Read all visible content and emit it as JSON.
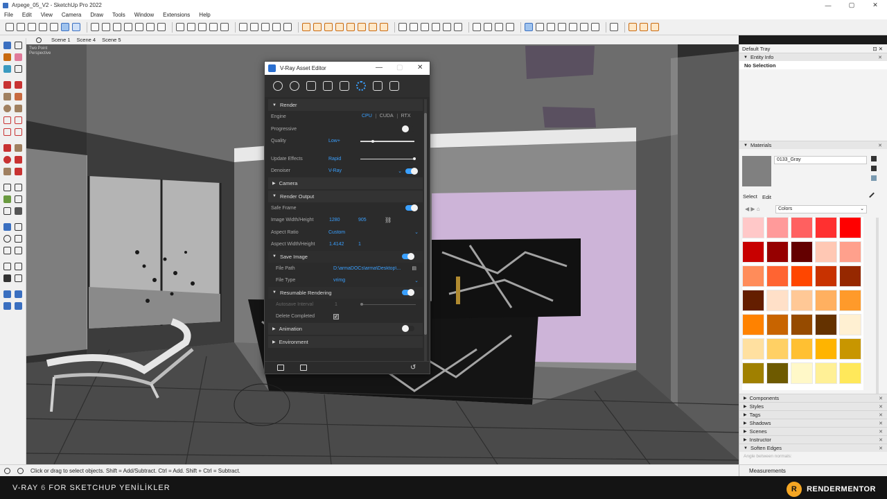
{
  "window": {
    "title": "Arpege_05_V2 - SketchUp Pro 2022",
    "minimize": "—",
    "maximize": "▢",
    "close": "✕"
  },
  "menu": [
    "File",
    "Edit",
    "View",
    "Camera",
    "Draw",
    "Tools",
    "Window",
    "Extensions",
    "Help"
  ],
  "scenes": [
    "Scene 1",
    "Scene 4",
    "Scene 5"
  ],
  "viewport": {
    "label1": "Two Point",
    "label2": "Perspective"
  },
  "status": {
    "hint": "Click or drag to select objects. Shift = Add/Subtract. Ctrl = Add. Shift + Ctrl = Subtract.",
    "measurements": "Measurements"
  },
  "footer": {
    "left_pre": "V-RAY ",
    "left_num": "6",
    "left_post": " FOR SKETCHUP YENİLİKLER",
    "right": "RENDERMENTOR",
    "logo": "R"
  },
  "tray": {
    "title": "Default Tray",
    "entity_info": "Entity Info",
    "no_selection": "No Selection",
    "materials": "Materials",
    "material_name": "0133_Gray",
    "select_tab": "Select",
    "edit_tab": "Edit",
    "library": "Colors",
    "panels": [
      "Components",
      "Styles",
      "Tags",
      "Shadows",
      "Scenes",
      "Instructor",
      "Soften Edges"
    ],
    "soften_hint": "Angle between normals:",
    "swatches": [
      "#ffc8c8",
      "#ff9a9a",
      "#ff6060",
      "#ff3030",
      "#ff0000",
      "#c80000",
      "#960000",
      "#640000",
      "#ffc8b4",
      "#ffa08c",
      "#ff8c5a",
      "#ff6432",
      "#ff4600",
      "#c83200",
      "#962800",
      "#641e00",
      "#ffe0c8",
      "#ffc896",
      "#ffb060",
      "#ff9a2a",
      "#ff8200",
      "#c86400",
      "#964b00",
      "#643200",
      "#fff0d2",
      "#ffe0a0",
      "#ffd064",
      "#ffc032",
      "#ffb400",
      "#c89600",
      "#a08000",
      "#6e5a00",
      "#fff8c8",
      "#fff096",
      "#ffe85a"
    ]
  },
  "vray": {
    "title": "V-Ray Asset Editor",
    "render": {
      "label": "Render",
      "engine": "Engine",
      "engine_opts": [
        "CPU",
        "CUDA",
        "RTX"
      ],
      "progressive": "Progressive",
      "quality": "Quality",
      "quality_val": "Low+",
      "update_effects": "Update Effects",
      "update_effects_val": "Rapid",
      "denoiser": "Denoiser",
      "denoiser_val": "V-Ray"
    },
    "camera": "Camera",
    "render_output": {
      "label": "Render Output",
      "safe_frame": "Safe Frame",
      "image_wh": "Image Width/Height",
      "width": "1280",
      "height": "905",
      "aspect_ratio": "Aspect Ratio",
      "aspect_ratio_val": "Custom",
      "aspect_wh": "Aspect Width/Height",
      "aspect_w": "1.4142",
      "aspect_h": "1"
    },
    "save_image": {
      "label": "Save Image",
      "file_path": "File Path",
      "file_path_val": "D:\\armaDOCs\\arma\\Desktop\\...",
      "file_type": "File Type",
      "file_type_val": "vrimg"
    },
    "resumable": {
      "label": "Resumable Rendering",
      "autosave": "Autosave Interval",
      "autosave_val": "1",
      "delete_completed": "Delete Completed"
    },
    "animation": "Animation",
    "environment": "Environment"
  }
}
